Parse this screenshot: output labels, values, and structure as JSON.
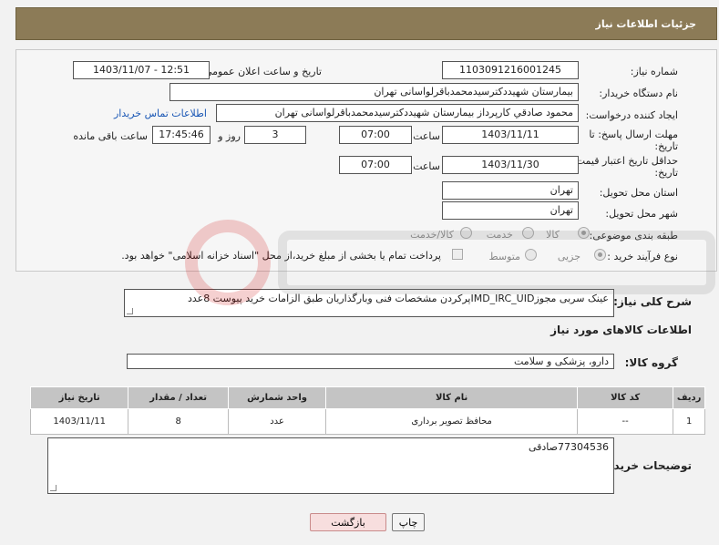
{
  "header": {
    "title": "جزئیات اطلاعات نیاز"
  },
  "labels": {
    "need_number": "شماره نیاز:",
    "announce_datetime": "تاریخ و ساعت اعلان عمومی:",
    "buyer_org": "نام دستگاه خریدار:",
    "requester": "ایجاد کننده درخواست:",
    "send_deadline": "مهلت ارسال پاسخ: تا",
    "send_deadline_2": "تاریخ:",
    "time": "ساعت",
    "days_and": "روز و",
    "hours_left": "ساعت باقی مانده",
    "price_validity": "حداقل تاریخ اعتبار قیمت: تا",
    "price_validity_2": "تاریخ:",
    "province": "استان محل تحویل:",
    "city": "شهر محل تحویل:",
    "category": "طبقه بندی موضوعی:",
    "purchase_type": "نوع فرآیند خرید :",
    "need_desc": "شرح کلی نیاز:",
    "goods_info": "اطلاعات کالاهای مورد نیاز",
    "goods_group": "گروه کالا:",
    "buyer_notes": "توضیحات خریدار:"
  },
  "fields": {
    "need_number": "1103091216001245",
    "announce_datetime": "1403/11/07 - 12:51",
    "buyer_org": "بیمارستان شهیددکترسیدمحمدباقرلواسانی تهران",
    "requester": "محمود صادقي کارپرداز بیمارستان شهیددکترسیدمحمدباقرلواسانی تهران",
    "contact_link": "اطلاعات تماس خریدار",
    "send_date": "1403/11/11",
    "send_time": "07:00",
    "days": "3",
    "remaining": "17:45:46",
    "validity_date": "1403/11/30",
    "validity_time": "07:00",
    "province": "تهران",
    "city": "تهران"
  },
  "category_options": [
    {
      "label": "کالا",
      "selected": true
    },
    {
      "label": "خدمت",
      "selected": false
    },
    {
      "label": "کالا/خدمت",
      "selected": false
    }
  ],
  "purchase_options": [
    {
      "label": "جزیی",
      "selected": true
    },
    {
      "label": "متوسط",
      "selected": false
    }
  ],
  "payment_note": "پرداخت تمام یا بخشی از مبلغ خرید،از محل \"اسناد خزانه اسلامی\" خواهد بود.",
  "need_desc": "عینک سربی مجوزIMD_IRC_UIDپرکردن مشخصات فنی وبارگذاریان طبق الزامات خرید پیوست 8عدد",
  "goods_group": "دارو، پزشکی و سلامت",
  "table": {
    "headers": [
      "ردیف",
      "کد کالا",
      "نام کالا",
      "واحد شمارش",
      "تعداد / مقدار",
      "تاریخ نیاز"
    ],
    "rows": [
      [
        "1",
        "--",
        "محافظ تصویر برداری",
        "عدد",
        "8",
        "1403/11/11"
      ]
    ]
  },
  "buyer_notes": "77304536صادقی",
  "buttons": {
    "print": "چاپ",
    "back": "بازگشت"
  }
}
